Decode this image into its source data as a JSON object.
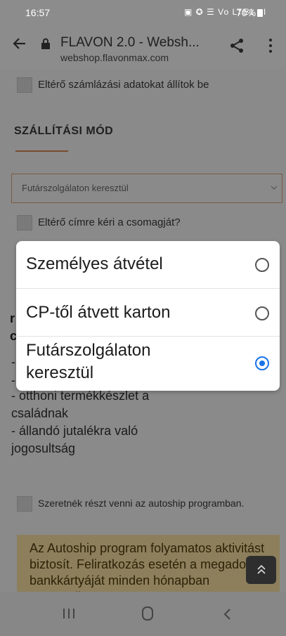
{
  "status_bar": {
    "time": "16:57",
    "icons_text": "▣ ✪ ☰ Vo LTE1 .ıl",
    "battery": "70%"
  },
  "browser": {
    "title": "FLAVON 2.0 - Websh...",
    "url": "webshop.flavonmax.com"
  },
  "page": {
    "billing_checkbox_label": "Eltérő számlázási adatokat állítok be",
    "shipping_section_title": "SZÁLLÍTÁSI MÓD",
    "shipping_select_value": "Futárszolgálaton keresztül",
    "diff_address_label": "Eltérő címre kéri a csomagját?",
    "hidden_letters": [
      "r",
      "c"
    ],
    "bullets": [
      "-",
      "-",
      "- otthoni termékkészlet a",
      "családnak",
      "- állandó jutalékra való",
      "jogosultság"
    ],
    "autoship_label": "Szeretnék részt venni az autoship programban.",
    "notice_text": "Az Autoship program folyamatos aktivitást biztosít. Feliratkozás esetén a megadott bankkártyáját minden hónapban automatikusan"
  },
  "dialog": {
    "options": [
      {
        "label": "Személyes átvétel",
        "selected": false
      },
      {
        "label": "CP-től átvett karton",
        "selected": false
      },
      {
        "label_line1": "Futárszolgálaton",
        "label_line2": "keresztül",
        "selected": true
      }
    ]
  },
  "colors": {
    "accent": "#1a73e8",
    "underline": "#7a4a30",
    "notice_bg": "#8d7f5c"
  },
  "icons": [
    "back-arrow",
    "lock",
    "share",
    "more-vert",
    "chevron-down",
    "chevron-up",
    "recent-apps",
    "home",
    "nav-back"
  ]
}
